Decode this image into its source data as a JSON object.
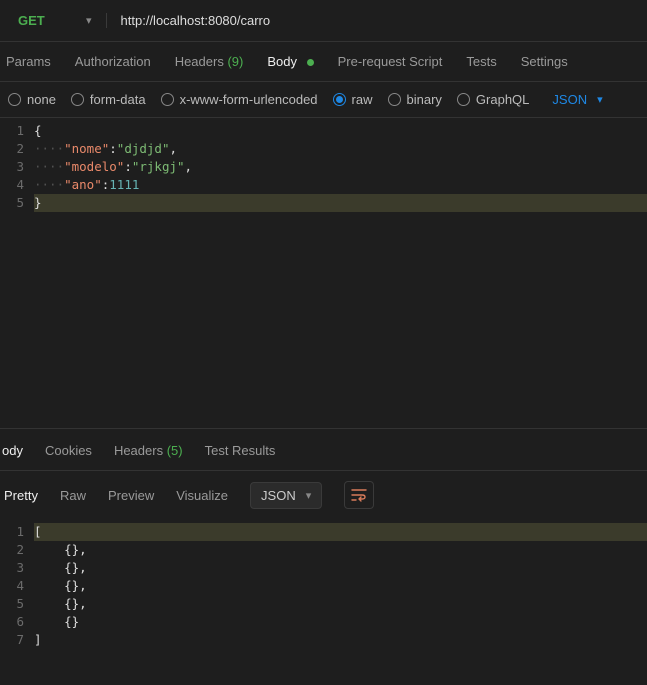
{
  "request": {
    "method": "GET",
    "url": "http://localhost:8080/carro"
  },
  "reqTabs": {
    "params": "Params",
    "authorization": "Authorization",
    "headers": "Headers",
    "headersCount": "(9)",
    "body": "Body",
    "prerequest": "Pre-request Script",
    "tests": "Tests",
    "settings": "Settings"
  },
  "bodyTypes": {
    "none": "none",
    "formData": "form-data",
    "urlencoded": "x-www-form-urlencoded",
    "raw": "raw",
    "binary": "binary",
    "graphql": "GraphQL",
    "rawFormat": "JSON"
  },
  "reqBodyJson": {
    "nome": "djdjd",
    "modelo": "rjkgj",
    "ano": 1111
  },
  "respTabs": {
    "body": "ody",
    "cookies": "Cookies",
    "headers": "Headers",
    "headersCount": "(5)",
    "testResults": "Test Results"
  },
  "respView": {
    "pretty": "Pretty",
    "raw": "Raw",
    "preview": "Preview",
    "visualize": "Visualize",
    "format": "JSON"
  },
  "respBody": [
    {},
    {},
    {},
    {},
    {}
  ]
}
